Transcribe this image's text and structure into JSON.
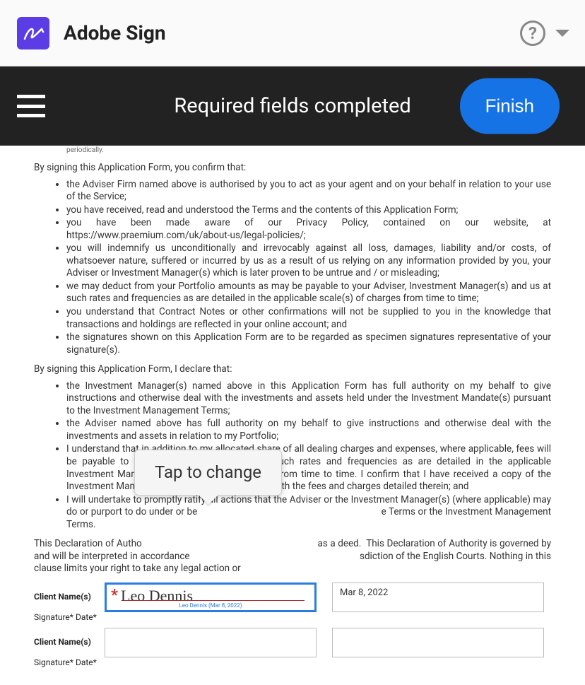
{
  "header": {
    "app_title": "Adobe Sign"
  },
  "status_bar": {
    "message": "Required fields completed",
    "finish_label": "Finish"
  },
  "tooltip": {
    "text": "Tap to change"
  },
  "doc": {
    "truncated_top": "periodically.",
    "confirm_intro": "By signing this Application Form, you confirm that:",
    "confirm_bullets": [
      "the Adviser Firm named above is authorised by you to act as your agent and on your behalf in relation to your use of the Service;",
      "you have received, read and understood the Terms and the contents of this Application Form;",
      "you have been made aware of our Privacy Policy, contained on our website, at https://www.praemium.com/uk/about-us/legal-policies/;",
      "you will indemnify us unconditionally and irrevocably against all loss, damages, liability and/or costs, of whatsoever nature, suffered or incurred by us as a result of us relying on any information provided by you, your Adviser or Investment Manager(s) which is later proven to be untrue and / or misleading;",
      "we may deduct from your Portfolio amounts as may be payable to your Adviser, Investment Manager(s) and us at such rates and frequencies as are detailed in the applicable scale(s) of charges from time to time;",
      "you understand that Contract Notes or other confirmations will not be supplied to you in the knowledge that transactions and holdings are reflected in your online account; and",
      "the signatures shown on this Application Form are to be regarded as specimen signatures representative of your signature(s)."
    ],
    "declare_intro": "By signing this Application Form, I declare that:",
    "declare_bullets": [
      "the Investment Manager(s) named above in this Application Form has full authority on my behalf to give instructions and otherwise deal with the investments and assets held under the Investment Mandate(s) pursuant to the Investment Management Terms;",
      "the Adviser named above has full authority on my behalf to give instructions and otherwise deal with the investments and assets in relation to my Portfolio;",
      "I understand that in addition to my allocated share of all dealing charges and expenses, where applicable, fees will be payable to the Investment Manager(s) at such rates and frequencies as are detailed in the applicable Investment Mandate(s) and scale(s) of charges from time to time. I confirm that I have received a copy of the Investment Mandate and that I am in agreement with the fees and charges detailed therein; and",
      "I will undertake to promptly ratify all actions that the Adviser or the Investment Manager(s) (where applicable) may do or purport to do under or be                                                                         e Terms or the Investment Management Terms."
    ],
    "declaration_para": "This Declaration of Autho                                                                      as a deed.  This Declaration of Authority is governed by and will be interpreted in accordance                                                                      sdiction of the English Courts. Nothing in this clause limits your right to take any legal action or",
    "fields": {
      "client_name_label": "Client Name(s)",
      "signature_date_label": "Signature* Date*",
      "row1": {
        "signature_name": "Leo Dennis",
        "signature_meta": "Leo Dennis    (Mar 8, 2022)",
        "date_value": "Mar 8, 2022"
      },
      "row2": {
        "signature_name": "",
        "date_value": ""
      }
    }
  }
}
